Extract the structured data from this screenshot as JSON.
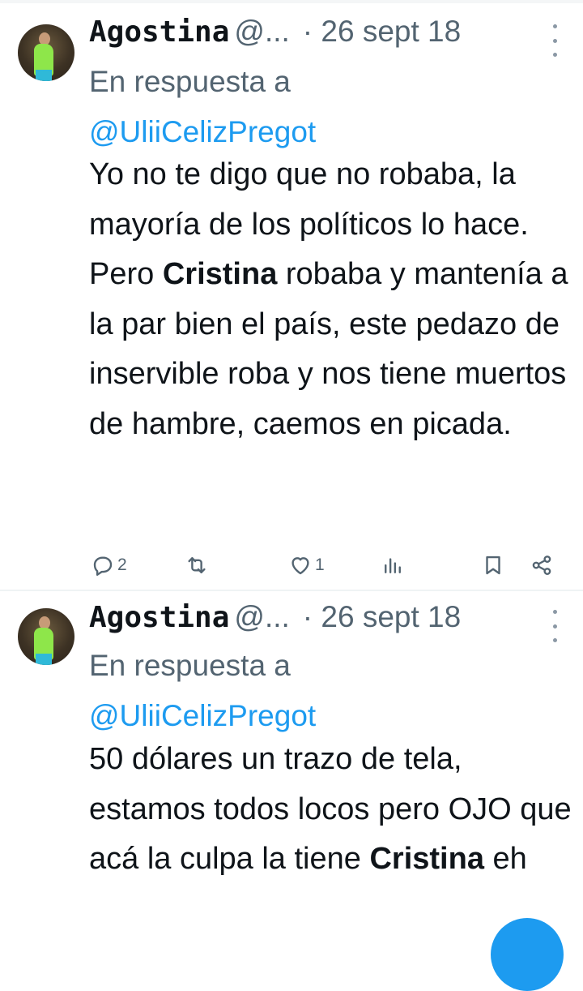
{
  "tweets": [
    {
      "name": "Agostina",
      "handle": "@...",
      "date": "· 26 sept 18",
      "reply_prefix": "En respuesta a",
      "reply_mention": "@UliiCelizPregot",
      "body_before": "Yo no te digo que no robaba, la mayoría de los políticos lo hace. Pero",
      "body_bold": "Cristina",
      "body_after": "robaba y mantenía a la par bien el país, este pedazo de inservible roba y nos tiene muertos de hambre, caemos en picada.",
      "actions": {
        "replies": "2",
        "retweets": "",
        "likes": "1"
      }
    },
    {
      "name": "Agostina",
      "handle": "@...",
      "date": "· 26 sept 18",
      "reply_prefix": "En respuesta a",
      "reply_mention": "@UliiCelizPregot",
      "body_before": "50 dólares un trazo de tela, estamos todos locos pero OJO que acá la culpa la tiene",
      "body_bold": "Cristina",
      "body_after": "eh"
    }
  ],
  "icons": {
    "reply": "reply-icon",
    "retweet": "retweet-icon",
    "like": "heart-icon",
    "views": "views-icon",
    "bookmark": "bookmark-icon",
    "share": "share-icon",
    "more": "more-icon",
    "compose": "compose-button"
  },
  "colors": {
    "text": "#0f1419",
    "secondary": "#536471",
    "accent": "#1d9bf0",
    "divider": "#eff3f4"
  }
}
